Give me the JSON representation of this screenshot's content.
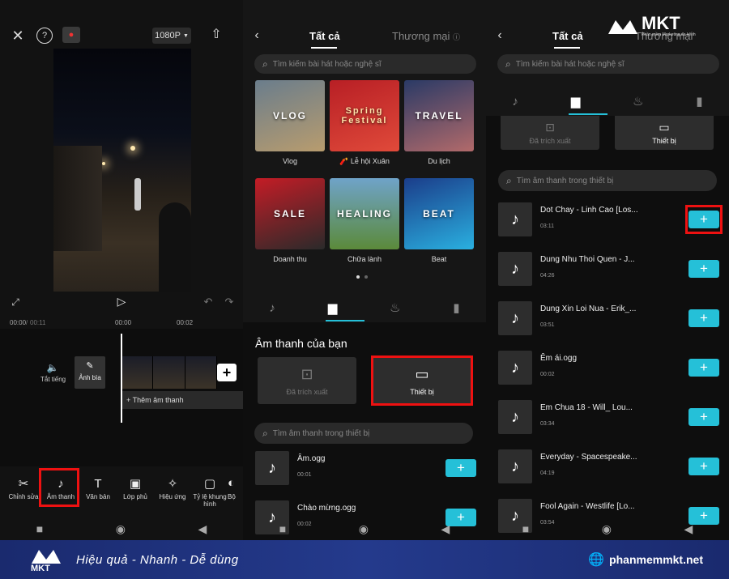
{
  "panel1": {
    "resolution": "1080P",
    "time_current": "00:00",
    "time_total": "00:11",
    "time_marks": [
      "00:00",
      "00:02"
    ],
    "mute_label": "Tắt tiếng",
    "cover_label": "Ảnh bìa",
    "add_audio_label": "+ Thêm âm thanh",
    "toolbar": [
      {
        "label": "Chỉnh sửa",
        "icon": "scissors-icon",
        "glyph": "✂"
      },
      {
        "label": "Âm thanh",
        "icon": "music-note-icon",
        "glyph": "♪"
      },
      {
        "label": "Văn bản",
        "icon": "text-icon",
        "glyph": "T"
      },
      {
        "label": "Lớp phủ",
        "icon": "overlay-icon",
        "glyph": "▣"
      },
      {
        "label": "Hiệu ứng",
        "icon": "effects-icon",
        "glyph": "✧"
      },
      {
        "label": "Tỷ lệ khung hình",
        "icon": "aspect-ratio-icon",
        "glyph": "▢"
      },
      {
        "label": "Bộ",
        "icon": "filter-icon",
        "glyph": "◐"
      }
    ]
  },
  "panel2": {
    "tab_all": "Tất cả",
    "tab_commercial": "Thương mại",
    "search_placeholder": "Tìm kiếm bài hát hoặc nghệ sĩ",
    "tiles": [
      {
        "title": "VLOG",
        "caption": "Vlog",
        "bg": "linear-gradient(160deg,#6a7d8c,#b89c6e)",
        "color": "#ffffff"
      },
      {
        "title": "Spring Festival",
        "caption": "🧨 Lễ hội Xuân",
        "bg": "linear-gradient(160deg,#b81f25,#e04a3a)",
        "color": "#ffe2a8"
      },
      {
        "title": "TRAVEL",
        "caption": "Du lịch",
        "bg": "linear-gradient(160deg,#2a3a66,#b26a6a)",
        "color": "#ffffff"
      },
      {
        "title": "SALE",
        "caption": "Doanh thu",
        "bg": "linear-gradient(160deg,#c41c26,#2a2a2a)",
        "color": "#ffffff"
      },
      {
        "title": "HEALING",
        "caption": "Chữa lành",
        "bg": "linear-gradient(180deg,#6fa3c9,#5b8a3a)",
        "color": "#ffffff"
      },
      {
        "title": "BEAT",
        "caption": "Beat",
        "bg": "linear-gradient(160deg,#1b3d8a,#2ab0e0)",
        "color": "#ffffff"
      }
    ],
    "section_title": "Âm thanh của bạn",
    "card_extracted": "Đã trích xuất",
    "card_device": "Thiết bị",
    "device_search_placeholder": "Tìm âm thanh trong thiết bị",
    "songs": [
      {
        "title": "Âm.ogg",
        "duration": "00:01"
      },
      {
        "title": "Chào mừng.ogg",
        "duration": "00:02"
      }
    ]
  },
  "panel3": {
    "tab_all": "Tất cả",
    "tab_commercial": "Thương mại",
    "search_placeholder": "Tìm kiếm bài hát hoặc nghệ sĩ",
    "card_extracted": "Đã trích xuất",
    "card_device": "Thiết bị",
    "device_search_placeholder": "Tìm âm thanh trong thiết bị",
    "songs": [
      {
        "title": "Dot Chay - Linh Cao [Los...",
        "duration": "03:11"
      },
      {
        "title": "Dung Nhu Thoi Quen - J...",
        "duration": "04:26"
      },
      {
        "title": "Dung Xin Loi Nua - Erik_...",
        "duration": "03:51"
      },
      {
        "title": "Êm ái.ogg",
        "duration": "00:02"
      },
      {
        "title": "Em Chua 18 - Will_ Lou...",
        "duration": "03:34"
      },
      {
        "title": "Everyday - Spacespeake...",
        "duration": "04:19"
      },
      {
        "title": "Fool Again - Westlife [Lo...",
        "duration": "03:54"
      }
    ]
  },
  "brand": {
    "logo_text": "MKT",
    "logo_sub": "Phần mềm Marketing đa kênh",
    "slogan": "Hiệu quả - Nhanh - Dễ dùng",
    "website": "phanmemmkt.net"
  },
  "colors": {
    "accent": "#25c0d8",
    "highlight": "#e11111",
    "footer": "#243a8c"
  }
}
